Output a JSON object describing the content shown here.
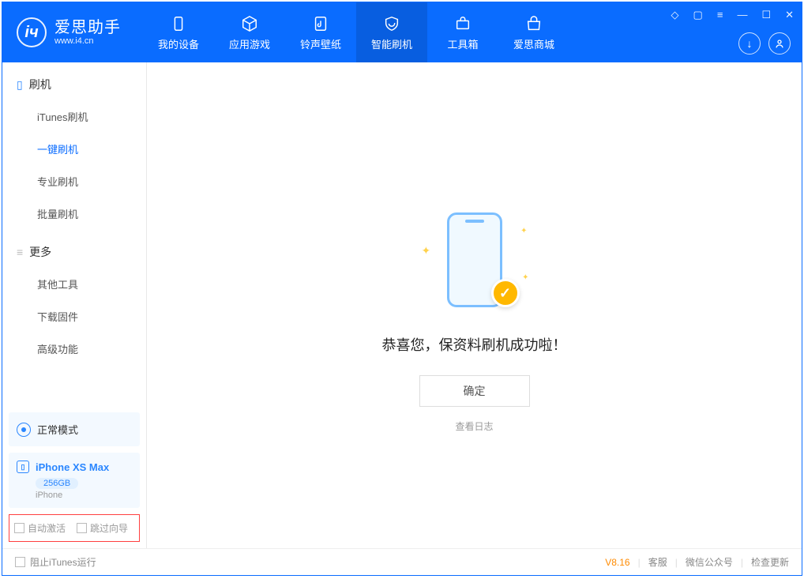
{
  "app": {
    "title": "爱思助手",
    "subtitle": "www.i4.cn"
  },
  "tabs": {
    "device": "我的设备",
    "apps": "应用游戏",
    "ringtones": "铃声壁纸",
    "smartflash": "智能刷机",
    "toolbox": "工具箱",
    "store": "爱思商城"
  },
  "sidebar": {
    "section1": "刷机",
    "items1": {
      "itunes": "iTunes刷机",
      "oneclick": "一键刷机",
      "pro": "专业刷机",
      "batch": "批量刷机"
    },
    "section2": "更多",
    "items2": {
      "othertools": "其他工具",
      "firmware": "下载固件",
      "advanced": "高级功能"
    }
  },
  "mode": {
    "label": "正常模式"
  },
  "device": {
    "name": "iPhone XS Max",
    "capacity": "256GB",
    "type": "iPhone"
  },
  "flags": {
    "auto_activate": "自动激活",
    "skip_guide": "跳过向导"
  },
  "main": {
    "message": "恭喜您，保资料刷机成功啦！",
    "ok": "确定",
    "view_log": "查看日志"
  },
  "footer": {
    "block_itunes": "阻止iTunes运行",
    "version": "V8.16",
    "support": "客服",
    "wechat": "微信公众号",
    "check_update": "检查更新"
  }
}
